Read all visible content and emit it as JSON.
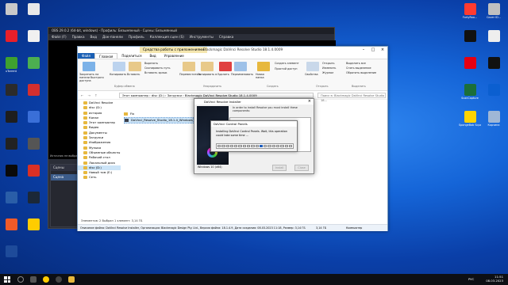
{
  "desktop": {
    "left_icons": [
      {
        "label": "",
        "color": "#c9c9c9"
      },
      {
        "label": "",
        "color": "#e8e8e8"
      },
      {
        "label": "",
        "color": "#e81f2a"
      },
      {
        "label": "",
        "color": "#f0f0f0"
      },
      {
        "label": "uTorrent",
        "color": "#3fa12f"
      },
      {
        "label": "",
        "color": "#4caf50"
      },
      {
        "label": "",
        "color": "#2b2b2b"
      },
      {
        "label": "",
        "color": "#d32f2f"
      },
      {
        "label": "",
        "color": "#1e1e1e"
      },
      {
        "label": "",
        "color": "#3a6fd8"
      },
      {
        "label": "",
        "color": "#222"
      },
      {
        "label": "",
        "color": "#555"
      },
      {
        "label": "",
        "color": "#0a0a0a"
      },
      {
        "label": "",
        "color": "#d93025"
      },
      {
        "label": "",
        "color": "#2a5ea8"
      },
      {
        "label": "",
        "color": "#1b2838"
      },
      {
        "label": "",
        "color": "#f05a28"
      },
      {
        "label": "",
        "color": "#ffcc00"
      },
      {
        "label": "",
        "color": "#1e4b9a"
      }
    ],
    "right_icons": [
      {
        "label": "FortyRoo...",
        "color": "#ff3b30"
      },
      {
        "label": "Cover ID...",
        "color": "#c0c0c0"
      },
      {
        "label": "",
        "color": "#111"
      },
      {
        "label": "",
        "color": "#eee"
      },
      {
        "label": "",
        "color": "#e60012"
      },
      {
        "label": "",
        "color": "#111"
      },
      {
        "label": "ScanCapture",
        "color": "#1b6f3a"
      },
      {
        "label": "",
        "color": "#0b5fd0"
      },
      {
        "label": "SpongeBob SquarePant...",
        "color": "#ffd400"
      },
      {
        "label": "Корзина",
        "color": "#9fb7d6"
      }
    ]
  },
  "obs": {
    "title": "OBS 29.0.2 (64-bit, windows) - Профиль: Безымянный - Сцены: Безымянный",
    "menu": [
      "Файл (F)",
      "Правка",
      "Вид",
      "Док-панели",
      "Профиль",
      "Коллекция сцен (S)",
      "Инструменты",
      "Справка"
    ],
    "warning": "Источник не выбран",
    "scenes_header": "Сцены",
    "scene_item": "Сцена"
  },
  "explorer": {
    "context_tab": "Средства работы с приложениями",
    "title": "Blackmagic DaVinci Resolve Studio 18.1.4.0009",
    "tabs": [
      "Файл",
      "Главная",
      "Поделиться",
      "Вид",
      "Управление"
    ],
    "selected_tab": "Главная",
    "ribbon": {
      "pin": "Закрепить на панели быстрого доступа",
      "copy": "Копировать",
      "paste": "Вставить",
      "cut": "Вырезать",
      "copy_path": "Скопировать путь",
      "paste_shortcut": "Вставить ярлык",
      "move": "Переместить в",
      "copy_to": "Копировать в",
      "delete": "Удалить",
      "rename": "Переименовать",
      "new_folder": "Новая папка",
      "new_item": "Создать элемент",
      "easy_access": "Простой доступ",
      "properties": "Свойства",
      "open": "Открыть",
      "edit": "Изменить",
      "history": "Журнал",
      "select_all": "Выделить все",
      "select_none": "Снять выделение",
      "invert": "Обратить выделение",
      "groups": [
        "Буфер обмена",
        "Упорядочить",
        "Создать",
        "Открыть",
        "Выделить"
      ]
    },
    "path": "Этот компьютер  ›  disc (D:)  ›  Загрузки  ›  Blackmagic DaVinci Resolve Studio 18.1.4.0009",
    "search_placeholder": "Поиск в: Blackmagic DaVinci Resolve Studio 18...",
    "nav_items": [
      "DaVinci Resolve",
      "disc (D:)",
      "история",
      "Канал",
      "Этот компьютер",
      "Видео",
      "Документы",
      "Загрузки",
      "Изображения",
      "Музыка",
      "Объемные объекты",
      "Рабочий стол",
      "Локальный диск",
      "disc (D:)",
      "Новый том (E:)",
      "Сеть"
    ],
    "selected_nav": "disc (D:)",
    "files": [
      "Fix",
      "DaVinci_Resolve_Studio_18.1.4_Windows"
    ],
    "status": "Элементов: 2    Выбран 1 элемент: 3,14 ГБ",
    "details": "Описание файла: DaVinci Resolve Installer, Организация: Blackmagic Design Pty. Ltd., Версия файла: 18.1.4.9, Дата создания: 08.03.2023 11:18, Размер: 3,14 ГБ",
    "details_size": "3,14 ГБ",
    "details_location": "Компьютер"
  },
  "installer": {
    "title": "DaVinci Resolve Installer",
    "message": "In order to install Resolve you must install these components:",
    "os": "Windows 10 (x64)",
    "install_label": "Install",
    "close_label": "Close"
  },
  "progress_dialog": {
    "title": "DaVinci Control Panels",
    "message": "Installing DaVinci Control Panels. Wait, this operation could take some time ...",
    "segments": 18,
    "filled_segment": 10
  },
  "taskbar": {
    "tray_lang": "РУС",
    "time": "11:51",
    "date": "08.03.2023"
  },
  "colors": {
    "accent": "#1a5fb4",
    "obs_bg": "#2b2e38",
    "progress": "#1f5fbf"
  }
}
